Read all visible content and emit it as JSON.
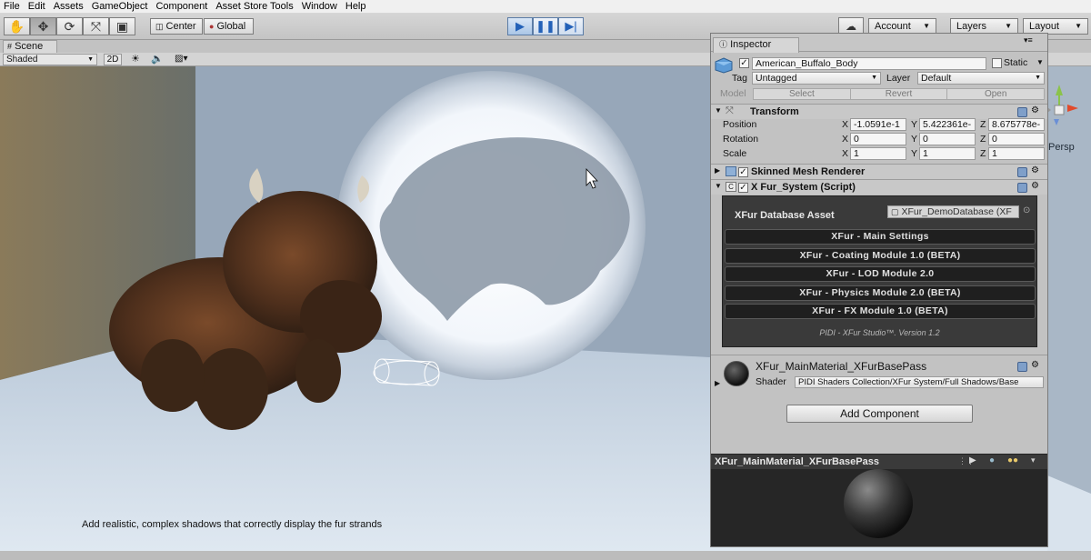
{
  "menu": [
    "File",
    "Edit",
    "Assets",
    "GameObject",
    "Component",
    "Asset Store Tools",
    "Window",
    "Help"
  ],
  "toolbar": {
    "pivot_label": "Center",
    "space_label": "Global",
    "account_label": "Account",
    "layers_label": "Layers",
    "layout_label": "Layout"
  },
  "scene": {
    "tab_label": "Scene",
    "shading_mode": "Shaded",
    "mode_2d": "2D",
    "gizmo_label": "Persp",
    "caption": "Add realistic, complex shadows that correctly display the fur strands"
  },
  "inspector": {
    "tab_label": "Inspector",
    "object_name": "American_Buffalo_Body",
    "static_label": "Static",
    "tag_label": "Tag",
    "tag_value": "Untagged",
    "layer_label": "Layer",
    "layer_value": "Default",
    "model_label": "Model",
    "model_select": "Select",
    "model_revert": "Revert",
    "model_open": "Open",
    "transform": {
      "title": "Transform",
      "position_label": "Position",
      "rotation_label": "Rotation",
      "scale_label": "Scale",
      "position": [
        "-1.0591e-1",
        "5.422361e-",
        "8.675778e-"
      ],
      "rotation": [
        "0",
        "0",
        "0"
      ],
      "scale": [
        "1",
        "1",
        "1"
      ],
      "axis_x": "X",
      "axis_y": "Y",
      "axis_z": "Z"
    },
    "skinned_mesh_title": "Skinned Mesh Renderer",
    "xfur": {
      "title": "X Fur_System (Script)",
      "database_label": "XFur Database Asset",
      "database_value": "XFur_DemoDatabase (XF",
      "buttons": [
        "XFur - Main Settings",
        "XFur - Coating Module 1.0 (BETA)",
        "XFur - LOD Module 2.0",
        "XFur - Physics Module 2.0 (BETA)",
        "XFur - FX Module 1.0 (BETA)"
      ],
      "footer": "PIDI - XFur Studio™. Version 1.2"
    },
    "material": {
      "name": "XFur_MainMaterial_XFurBasePass",
      "shader_label": "Shader",
      "shader_value": "PIDI Shaders Collection/XFur System/Full Shadows/Base"
    },
    "add_component": "Add Component",
    "preview_title": "XFur_MainMaterial_XFurBasePass"
  }
}
